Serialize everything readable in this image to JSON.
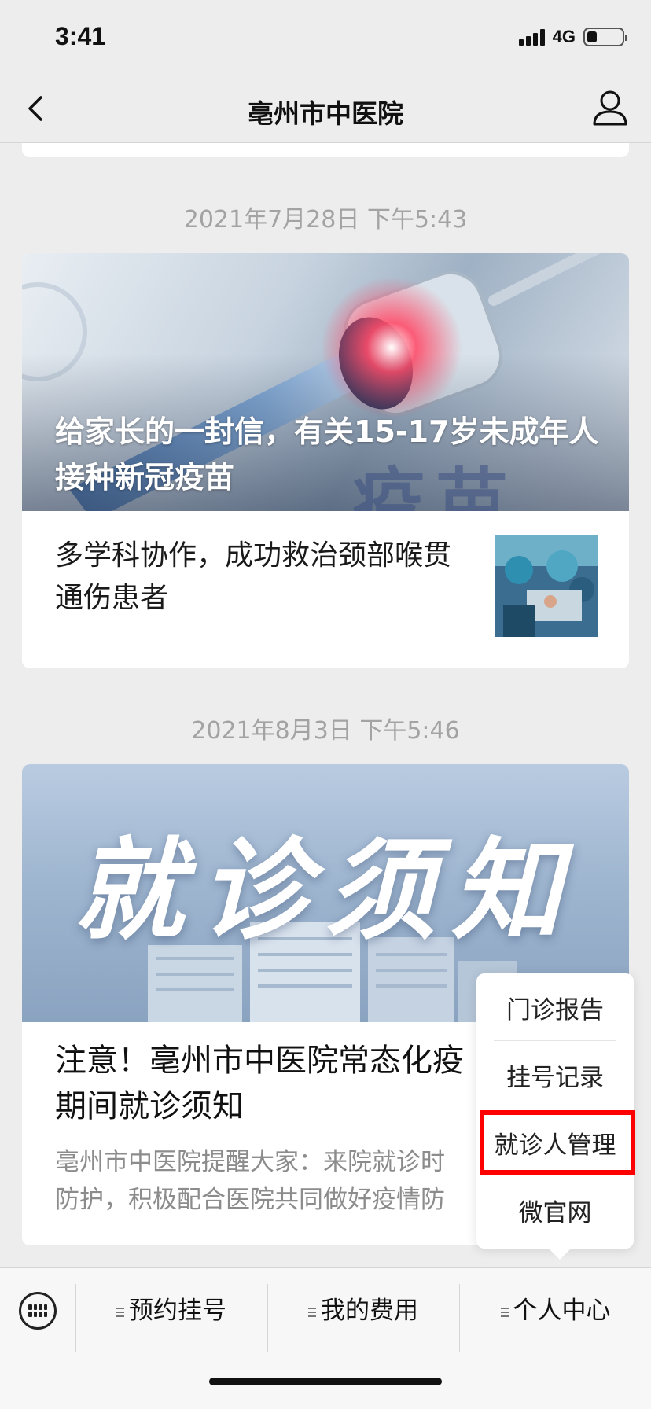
{
  "status_bar": {
    "time": "3:41",
    "network": "4G"
  },
  "nav": {
    "title": "亳州市中医院"
  },
  "feed": [
    {
      "date": "2021年7月28日 下午5:43",
      "headline": "给家长的一封信，有关15-17岁未成年人接种新冠疫苗",
      "hero_overlay_text": "疫苗",
      "sub_item": "多学科协作，成功救治颈部喉贯通伤患者"
    },
    {
      "date": "2021年8月3日 下午5:46",
      "hero_text": "就诊须知",
      "title_line1": "注意！亳州市中医院常态化疫",
      "title_line2": "期间就诊须知",
      "desc_line1": "亳州市中医院提醒大家：来院就诊时",
      "desc_line2": "防护，积极配合医院共同做好疫情防"
    }
  ],
  "popup_menu": {
    "items": [
      "门诊报告",
      "挂号记录",
      "就诊人管理",
      "微官网"
    ],
    "highlighted_index": 2,
    "highlight_color": "#ff0000"
  },
  "bottom_menu": {
    "tabs": [
      "预约挂号",
      "我的费用",
      "个人中心"
    ]
  },
  "colors": {
    "background": "#ededed",
    "card": "#ffffff",
    "date_text": "#a3a3a3"
  }
}
